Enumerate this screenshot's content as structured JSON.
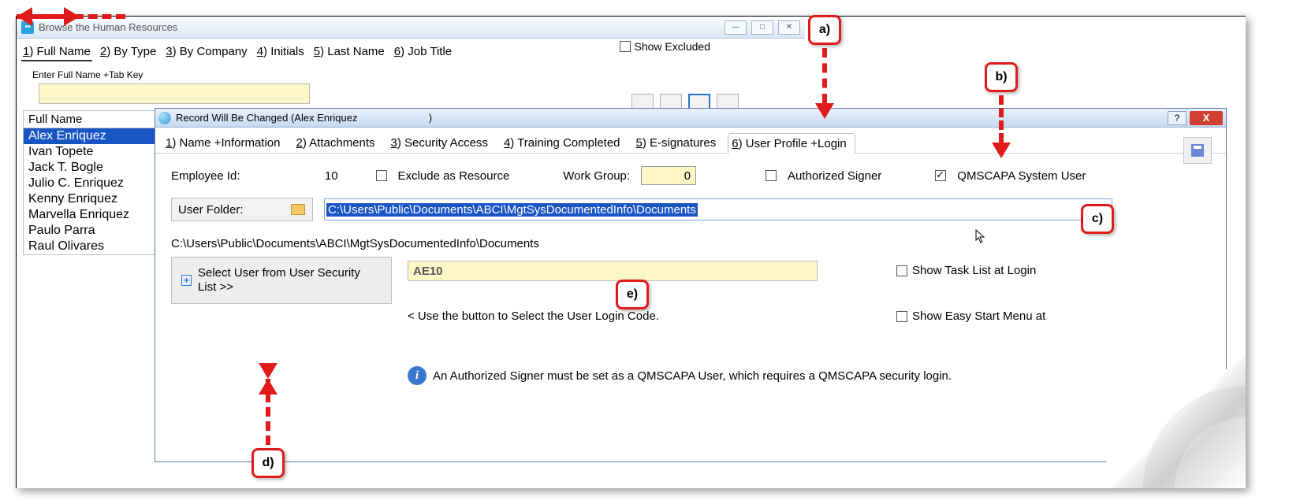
{
  "outer": {
    "title": "Browse the Human Resources",
    "tabs": [
      "1) Full Name",
      "2) By Type",
      "3) By Company",
      "4) Initials",
      "5) Last Name",
      "6) Job Title"
    ],
    "show_excluded": "Show Excluded",
    "hint_label": "Enter Full Name +Tab Key",
    "list_header": "Full Name",
    "list_items": [
      "Alex Enriquez",
      "Ivan Topete",
      "Jack T. Bogle",
      "Julio C. Enriquez",
      "Kenny Enriquez",
      "Marvella Enriquez",
      "Paulo Parra",
      "Raul Olivares"
    ],
    "selected_index": 0
  },
  "dialog": {
    "title": "Record Will Be Changed  (Alex Enriquez",
    "title_tail": ")",
    "tabs": [
      "1) Name +Information",
      "2) Attachments",
      "3) Security Access",
      "4) Training Completed",
      "5) E-signatures",
      "6) User Profile +Login"
    ],
    "active_tab": 5,
    "employee_id_label": "Employee Id:",
    "employee_id_value": "10",
    "exclude_label": "Exclude as Resource",
    "work_group_label": "Work Group:",
    "work_group_value": "0",
    "auth_signer_label": "Authorized Signer",
    "sys_user_label": "QMSCAPA System User",
    "user_folder_btn": "User Folder:",
    "path_value": "C:\\Users\\Public\\Documents\\ABCI\\MgtSysDocumentedInfo\\Documents",
    "path_display": "C:\\Users\\Public\\Documents\\ABCI\\MgtSysDocumentedInfo\\Documents",
    "select_user_btn": "Select User from User Security List >>",
    "login_code": "AE10",
    "login_hint": "<  Use the button to Select the User Login Code.",
    "show_task_label": "Show Task List at Login",
    "show_easy_label": "Show Easy Start Menu at",
    "info_text": "An Authorized Signer must be set as a QMSCAPA User, which requires a QMSCAPA security login."
  },
  "annotations": {
    "a": "a)",
    "b": "b)",
    "c": "c)",
    "d": "d)",
    "e": "e)"
  }
}
